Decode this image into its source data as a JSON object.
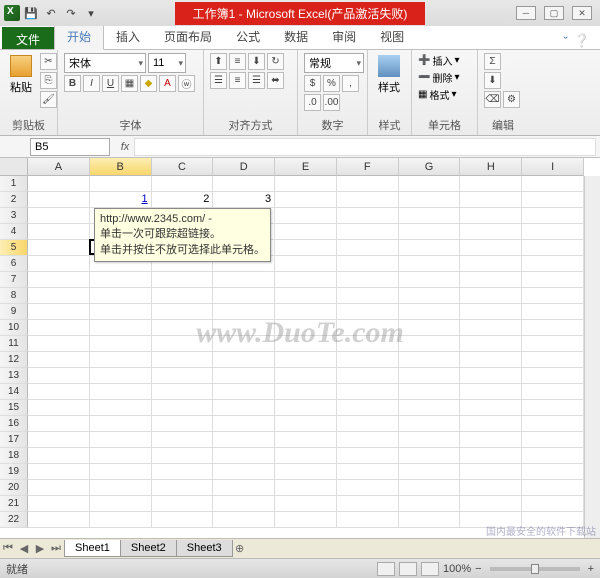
{
  "title": "工作簿1 - Microsoft Excel(产品激活失败)",
  "tabs": {
    "file": "文件",
    "home": "开始",
    "insert": "插入",
    "layout": "页面布局",
    "formulas": "公式",
    "data": "数据",
    "review": "审阅",
    "view": "视图"
  },
  "ribbon": {
    "clipboard": {
      "label": "剪贴板",
      "paste": "粘贴"
    },
    "font": {
      "label": "字体",
      "name": "宋体",
      "size": "11"
    },
    "align": {
      "label": "对齐方式",
      "wrap": "常规"
    },
    "number": {
      "label": "数字",
      "format": "常规"
    },
    "styles": {
      "label": "样式",
      "btn": "样式"
    },
    "cells": {
      "label": "单元格",
      "insert": "插入",
      "delete": "删除",
      "format": "格式"
    },
    "editing": {
      "label": "编辑"
    }
  },
  "namebox": "B5",
  "columns": [
    "A",
    "B",
    "C",
    "D",
    "E",
    "F",
    "G",
    "H",
    "I"
  ],
  "rows": 22,
  "cellsData": {
    "r2": {
      "B": "1",
      "C": "2",
      "D": "3"
    }
  },
  "tooltip": {
    "line1": "http://www.2345.com/ -",
    "line2": "单击一次可跟踪超链接。",
    "line3": "单击并按住不放可选择此单元格。"
  },
  "watermark": "www.DuoTe.com",
  "sheets": [
    "Sheet1",
    "Sheet2",
    "Sheet3"
  ],
  "status": "就绪",
  "zoom": "100%",
  "selectedCell": {
    "col": "B",
    "row": 5
  },
  "cornerText": "国内最安全的软件下载站"
}
